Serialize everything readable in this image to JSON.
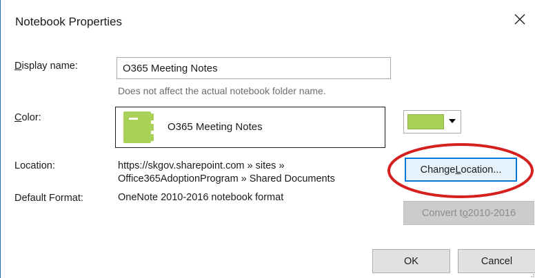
{
  "dialog": {
    "title": "Notebook Properties"
  },
  "display_name": {
    "label_key": "D",
    "label_rest": "isplay name:",
    "value": "O365 Meeting Notes",
    "hint": "Does not affect the actual notebook folder name."
  },
  "color": {
    "label_key": "C",
    "label_rest": "olor:",
    "notebook_name": "O365 Meeting Notes",
    "notebook_color": "#a9d157",
    "icon": "notebook-icon"
  },
  "location": {
    "label": "Location:",
    "line1": "https://skgov.sharepoint.com » sites »",
    "line2": "Office365AdoptionProgram » Shared Documents"
  },
  "default_format": {
    "label": "Default Format:",
    "value": "OneNote 2010-2016 notebook format"
  },
  "buttons": {
    "change_location_pre": "Change ",
    "change_location_key": "L",
    "change_location_post": "ocation...",
    "convert_pre": "Convert t",
    "convert_key": "o",
    "convert_post": " 2010-2016",
    "ok": "OK",
    "cancel": "Cancel"
  },
  "annotation_color": "#d61f1f",
  "accent_color": "#0078d7"
}
